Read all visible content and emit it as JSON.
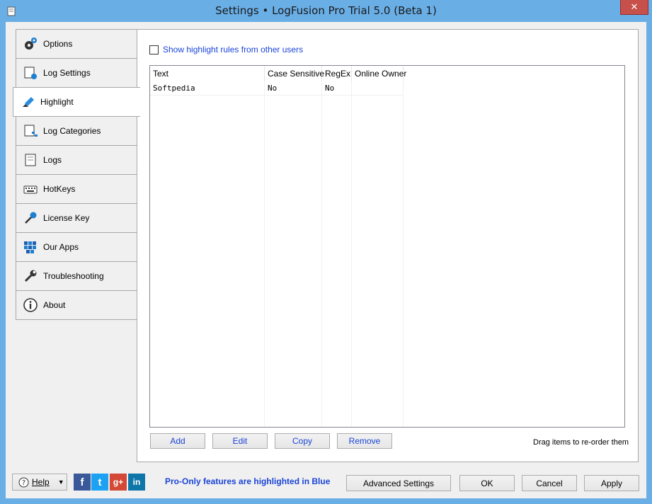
{
  "window": {
    "title": "Settings • LogFusion Pro Trial 5.0 (Beta 1)",
    "close_glyph": "✕"
  },
  "nav": {
    "items": [
      {
        "label": "Options",
        "icon": "gears-icon"
      },
      {
        "label": "Log Settings",
        "icon": "scroll-gear-icon"
      },
      {
        "label": "Highlight",
        "icon": "highlighter-icon",
        "active": true
      },
      {
        "label": "Log Categories",
        "icon": "scroll-tree-icon"
      },
      {
        "label": "Logs",
        "icon": "scroll-icon"
      },
      {
        "label": "HotKeys",
        "icon": "keyboard-icon"
      },
      {
        "label": "License Key",
        "icon": "key-icon"
      },
      {
        "label": "Our Apps",
        "icon": "grid-apps-icon"
      },
      {
        "label": "Troubleshooting",
        "icon": "wrench-icon"
      },
      {
        "label": "About",
        "icon": "info-icon"
      }
    ]
  },
  "highlight": {
    "show_other_users_label": "Show highlight rules from other users",
    "show_other_users_checked": false,
    "columns": [
      "Text",
      "Case Sensitive",
      "RegEx",
      "Online Owner"
    ],
    "rows": [
      {
        "text": "Softpedia",
        "case_sensitive": "No",
        "regex": "No",
        "online_owner": ""
      }
    ],
    "buttons": {
      "add": "Add",
      "edit": "Edit",
      "copy": "Copy",
      "remove": "Remove"
    },
    "drag_hint": "Drag items to re-order them"
  },
  "footer": {
    "help_label": "Help",
    "pro_note": "Pro-Only features are highlighted in Blue",
    "social": {
      "facebook": "f",
      "twitter": "t",
      "googleplus": "g+",
      "linkedin": "in"
    },
    "advanced_settings": "Advanced Settings",
    "ok": "OK",
    "cancel": "Cancel",
    "apply": "Apply"
  },
  "colors": {
    "chrome": "#6aaee6",
    "pro_blue": "#1a44d6",
    "close_red": "#c7504b"
  }
}
